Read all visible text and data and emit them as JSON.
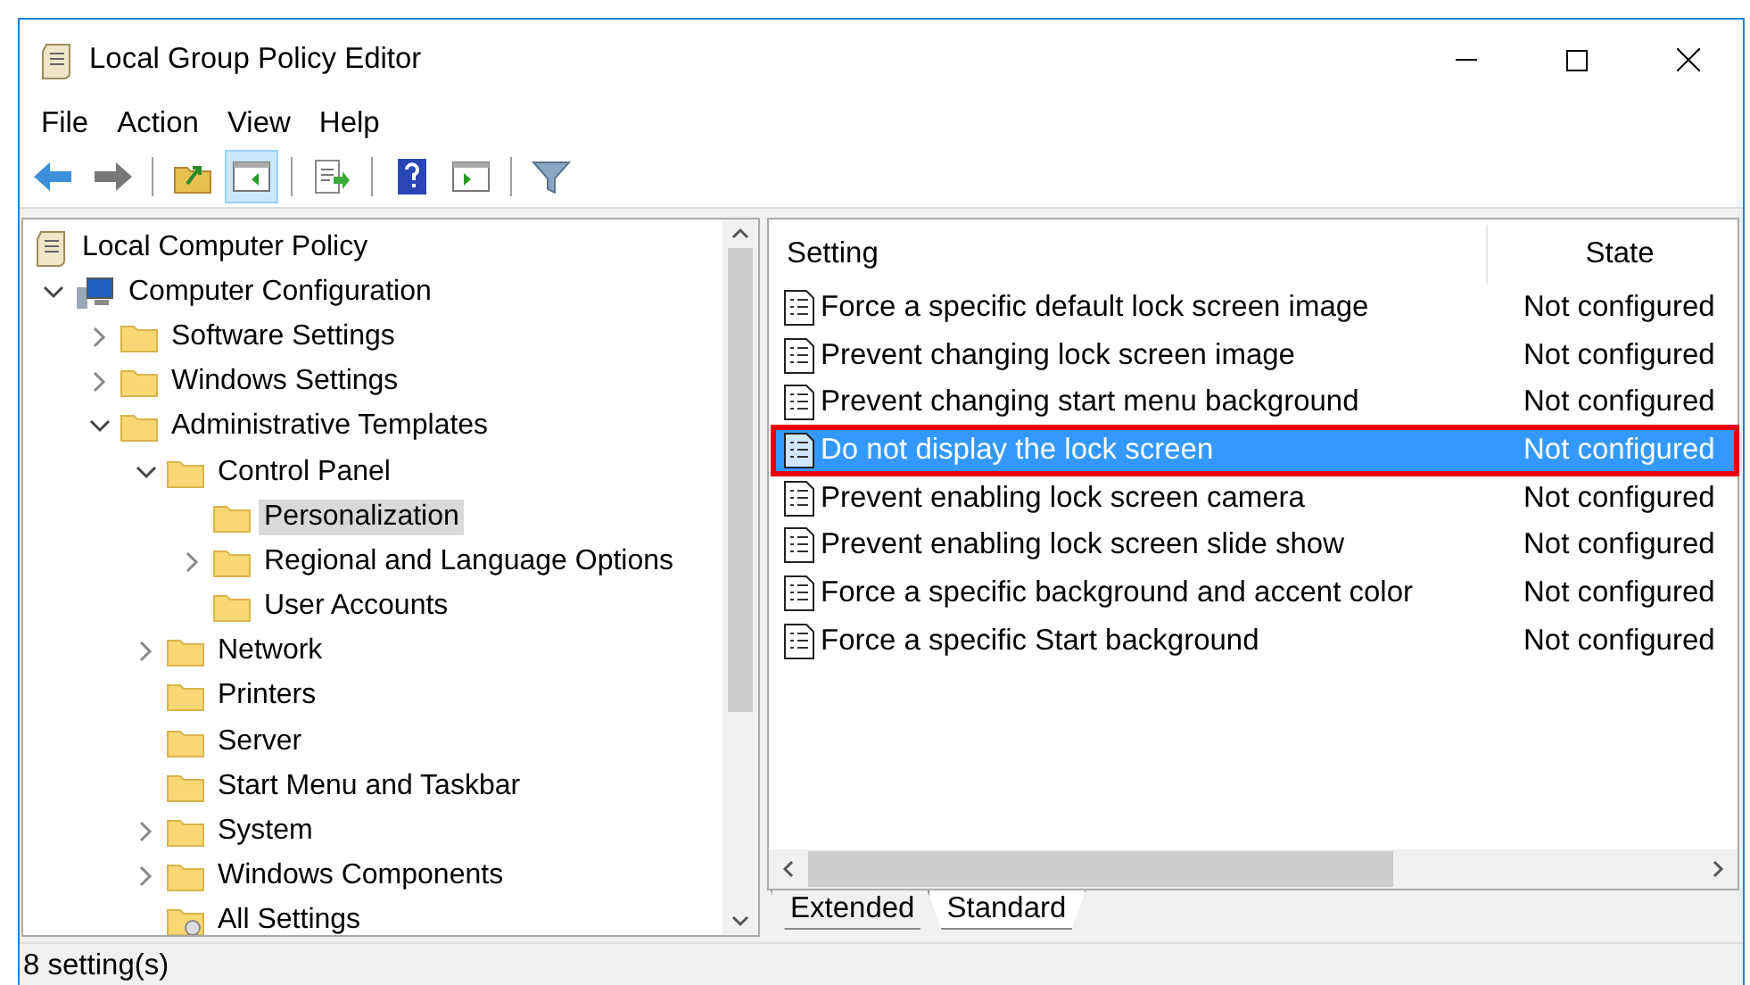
{
  "window": {
    "title": "Local Group Policy Editor"
  },
  "menu": [
    {
      "label": "File"
    },
    {
      "label": "Action"
    },
    {
      "label": "View"
    },
    {
      "label": "Help"
    }
  ],
  "toolbar": [
    {
      "kind": "back",
      "pressed": false
    },
    {
      "kind": "forward",
      "pressed": false
    },
    {
      "kind": "separator"
    },
    {
      "kind": "up",
      "pressed": false
    },
    {
      "kind": "tree",
      "pressed": true
    },
    {
      "kind": "separator"
    },
    {
      "kind": "export",
      "pressed": false
    },
    {
      "kind": "separator"
    },
    {
      "kind": "help",
      "pressed": false
    },
    {
      "kind": "pane",
      "pressed": false
    },
    {
      "kind": "separator"
    },
    {
      "kind": "filter",
      "pressed": false
    }
  ],
  "tree": [
    {
      "label": "Local Computer Policy",
      "kind": "policy",
      "selected": false,
      "children": [
        {
          "label": "Computer Configuration",
          "kind": "computer",
          "expandable": true,
          "expanded": true,
          "selected": false,
          "children": [
            {
              "label": "Software Settings",
              "kind": "folder",
              "expandable": true,
              "expanded": false,
              "selected": false
            },
            {
              "label": "Windows Settings",
              "kind": "folder",
              "expandable": true,
              "expanded": false,
              "selected": false
            },
            {
              "label": "Administrative Templates",
              "kind": "folder",
              "expandable": true,
              "expanded": true,
              "selected": false,
              "children": [
                {
                  "label": "Control Panel",
                  "kind": "folder",
                  "expandable": true,
                  "expanded": true,
                  "selected": false,
                  "children": [
                    {
                      "label": "Personalization",
                      "kind": "folder",
                      "expandable": false,
                      "selected": true
                    },
                    {
                      "label": "Regional and Language Options",
                      "kind": "folder",
                      "expandable": true,
                      "expanded": false,
                      "selected": false
                    },
                    {
                      "label": "User Accounts",
                      "kind": "folder",
                      "expandable": false,
                      "selected": false
                    }
                  ]
                },
                {
                  "label": "Network",
                  "kind": "folder",
                  "expandable": true,
                  "expanded": false,
                  "selected": false
                },
                {
                  "label": "Printers",
                  "kind": "folder",
                  "expandable": false,
                  "selected": false
                },
                {
                  "label": "Server",
                  "kind": "folder",
                  "expandable": false,
                  "selected": false
                },
                {
                  "label": "Start Menu and Taskbar",
                  "kind": "folder",
                  "expandable": false,
                  "selected": false
                },
                {
                  "label": "System",
                  "kind": "folder",
                  "expandable": true,
                  "expanded": false,
                  "selected": false
                },
                {
                  "label": "Windows Components",
                  "kind": "folder",
                  "expandable": true,
                  "expanded": false,
                  "selected": false
                },
                {
                  "label": "All Settings",
                  "kind": "settings",
                  "expandable": false,
                  "selected": false
                }
              ]
            }
          ]
        }
      ]
    }
  ],
  "table": {
    "columns": [
      "Setting",
      "State"
    ],
    "rows": [
      {
        "setting": "Force a specific default lock screen image",
        "state": "Not configured",
        "selected": false,
        "outlined": false
      },
      {
        "setting": "Prevent changing lock screen image",
        "state": "Not configured",
        "selected": false,
        "outlined": false
      },
      {
        "setting": "Prevent changing start menu background",
        "state": "Not configured",
        "selected": false,
        "outlined": false
      },
      {
        "setting": "Do not display the lock screen",
        "state": "Not configured",
        "selected": true,
        "outlined": true
      },
      {
        "setting": "Prevent enabling lock screen camera",
        "state": "Not configured",
        "selected": false,
        "outlined": false
      },
      {
        "setting": "Prevent enabling lock screen slide show",
        "state": "Not configured",
        "selected": false,
        "outlined": false
      },
      {
        "setting": "Force a specific background and accent color",
        "state": "Not configured",
        "selected": false,
        "outlined": false
      },
      {
        "setting": "Force a specific Start background",
        "state": "Not configured",
        "selected": false,
        "outlined": false
      }
    ]
  },
  "tabs": [
    {
      "label": "Extended",
      "selected": false
    },
    {
      "label": "Standard",
      "selected": true
    }
  ],
  "status_bar": "8 setting(s)"
}
